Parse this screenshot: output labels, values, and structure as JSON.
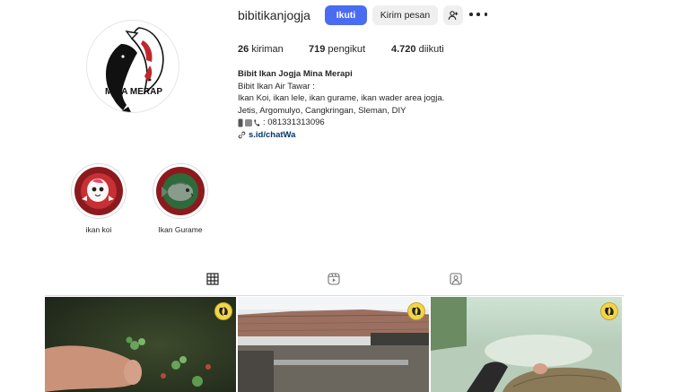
{
  "profile": {
    "username": "bibitikanjogja",
    "avatar_text": "MINA MERAP"
  },
  "actions": {
    "follow_label": "Ikuti",
    "message_label": "Kirim pesan"
  },
  "stats": [
    {
      "value": "26",
      "label": "kiriman"
    },
    {
      "value": "719",
      "label": "pengikut"
    },
    {
      "value": "4.720",
      "label": "diikuti"
    }
  ],
  "bio": {
    "name": "Bibit Ikan Jogja Mina Merapi",
    "lines": [
      "Bibit Ikan Air Tawar :",
      "Ikan Koi, ikan lele, ikan gurame, ikan wader area jogja.",
      "Jetis, Argomulyo, Cangkringan, Sleman, DIY",
      ": 081331313096"
    ],
    "link": "s.id/chatWa"
  },
  "highlights": [
    {
      "label": "ikan koi"
    },
    {
      "label": "Ikan Gurame"
    }
  ],
  "icons": {
    "posts_tab": "grid-icon",
    "reels_tab": "reels-icon",
    "tagged_tab": "tagged-icon"
  },
  "colors": {
    "follow_button": "#4a6cf0",
    "secondary_button": "#efefef",
    "link": "#00376b"
  }
}
